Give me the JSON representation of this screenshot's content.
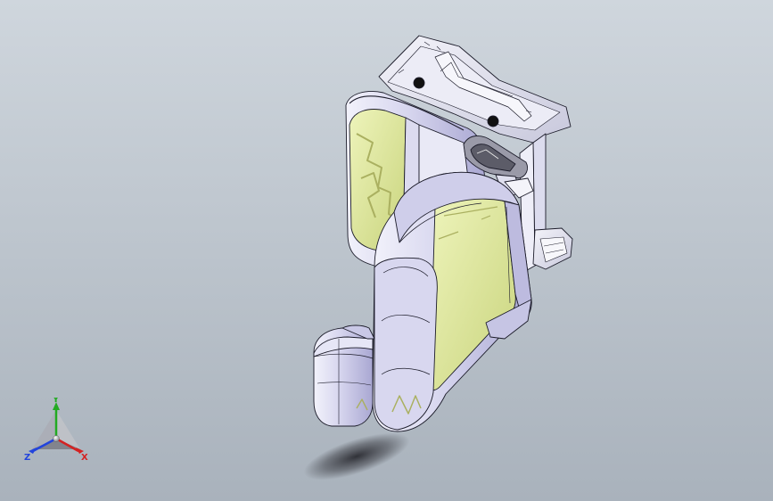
{
  "colors": {
    "background_top": "#cfd6dd",
    "background_bottom": "#a9b2bc",
    "shell_fill": "#d9d8f0",
    "shell_shade": "#b9b7dc",
    "trim_fill": "#e3eca3",
    "trim_shade": "#c7d37a",
    "edge_line": "#1c1c2a",
    "shadow": "#2a2a30",
    "axis_x": "#d42222",
    "axis_y": "#22aa22",
    "axis_z": "#2244dd"
  },
  "triad": {
    "x_label": "X",
    "y_label": "Y",
    "z_label": "Z"
  }
}
